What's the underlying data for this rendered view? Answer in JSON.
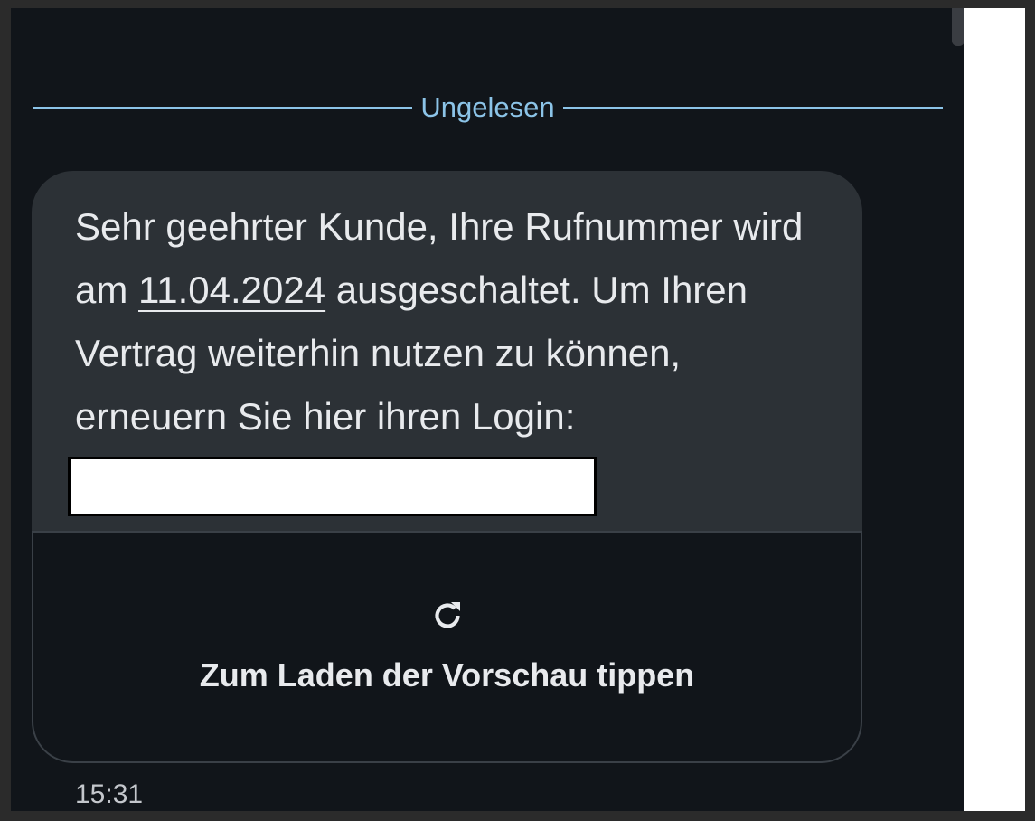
{
  "divider": {
    "label": "Ungelesen"
  },
  "message": {
    "text_before_date": "Sehr geehrter Kunde, Ihre Rufnummer wird am ",
    "date_link": "11.04.2024",
    "text_after_date": " ausgeschaltet. Um Ihren Vertrag weiterhin nutzen zu können, erneuern Sie hier ihren Login:",
    "link_redacted": true
  },
  "preview": {
    "icon": "refresh-icon",
    "label": "Zum Laden der Vorschau tippen"
  },
  "timestamp": "15:31",
  "colors": {
    "background": "#11151a",
    "bubble": "#2c3136",
    "accent": "#8cc4e8",
    "text": "#e8eaed"
  }
}
